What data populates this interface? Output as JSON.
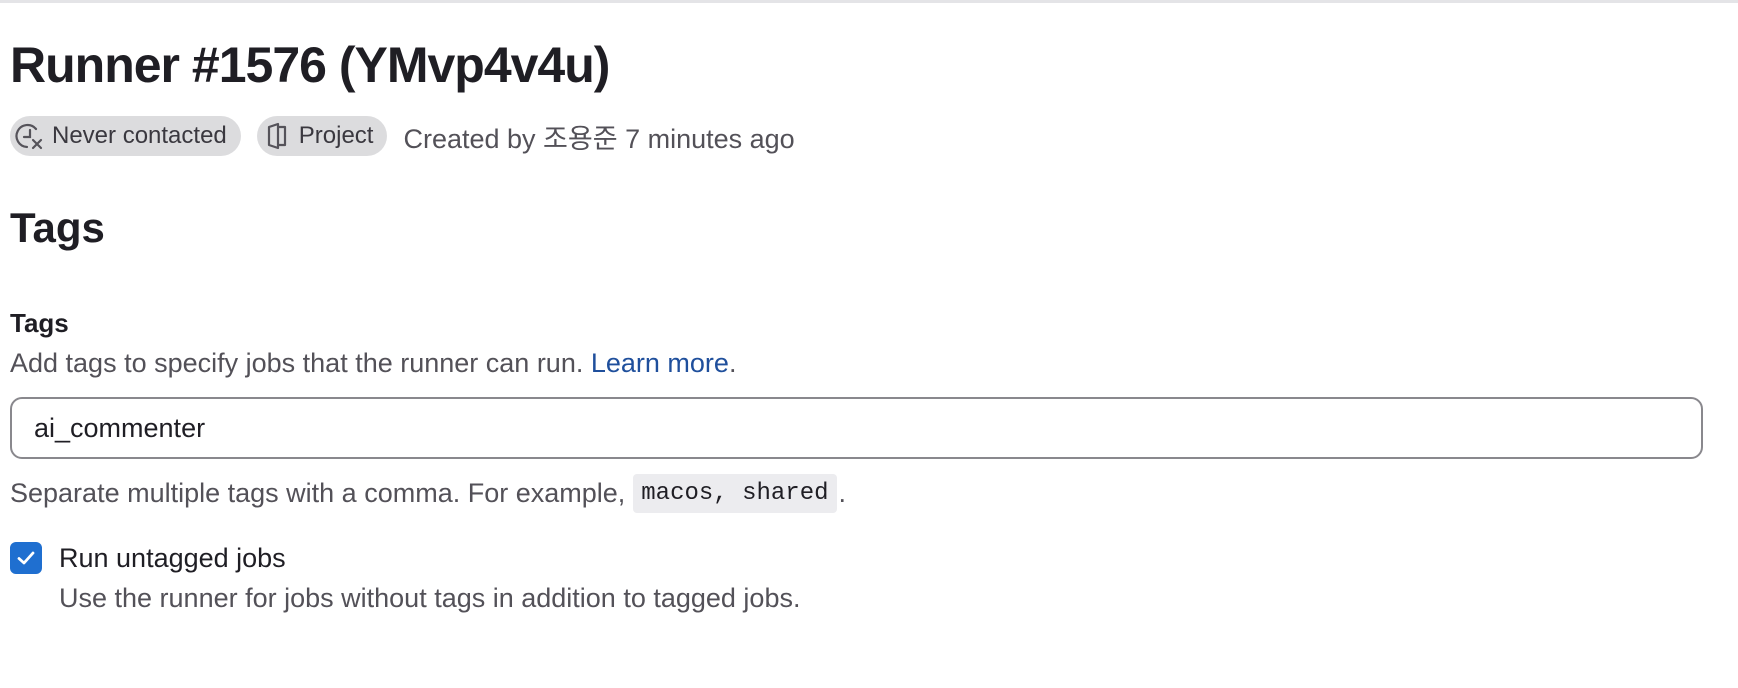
{
  "header": {
    "title": "Runner #1576 (YMvp4v4u)",
    "status_badge": {
      "label": "Never contacted",
      "icon": "clock-cancel-icon"
    },
    "type_badge": {
      "label": "Project",
      "icon": "project-icon"
    },
    "created_text": "Created by 조용준 7 minutes ago"
  },
  "tags_section": {
    "title": "Tags",
    "field_label": "Tags",
    "description": "Add tags to specify jobs that the runner can run.",
    "learn_more_label": "Learn more",
    "description_suffix": ".",
    "input_value": "ai_commenter",
    "help_prefix": "Separate multiple tags with a comma. For example,",
    "help_example": "macos, shared",
    "help_suffix": ".",
    "run_untagged": {
      "checked": true,
      "label": "Run untagged jobs",
      "help": "Use the runner for jobs without tags in addition to tagged jobs."
    }
  },
  "colors": {
    "accent": "#1f6fd0",
    "link": "#1f4f9c",
    "badge_bg": "#dcdcde"
  }
}
